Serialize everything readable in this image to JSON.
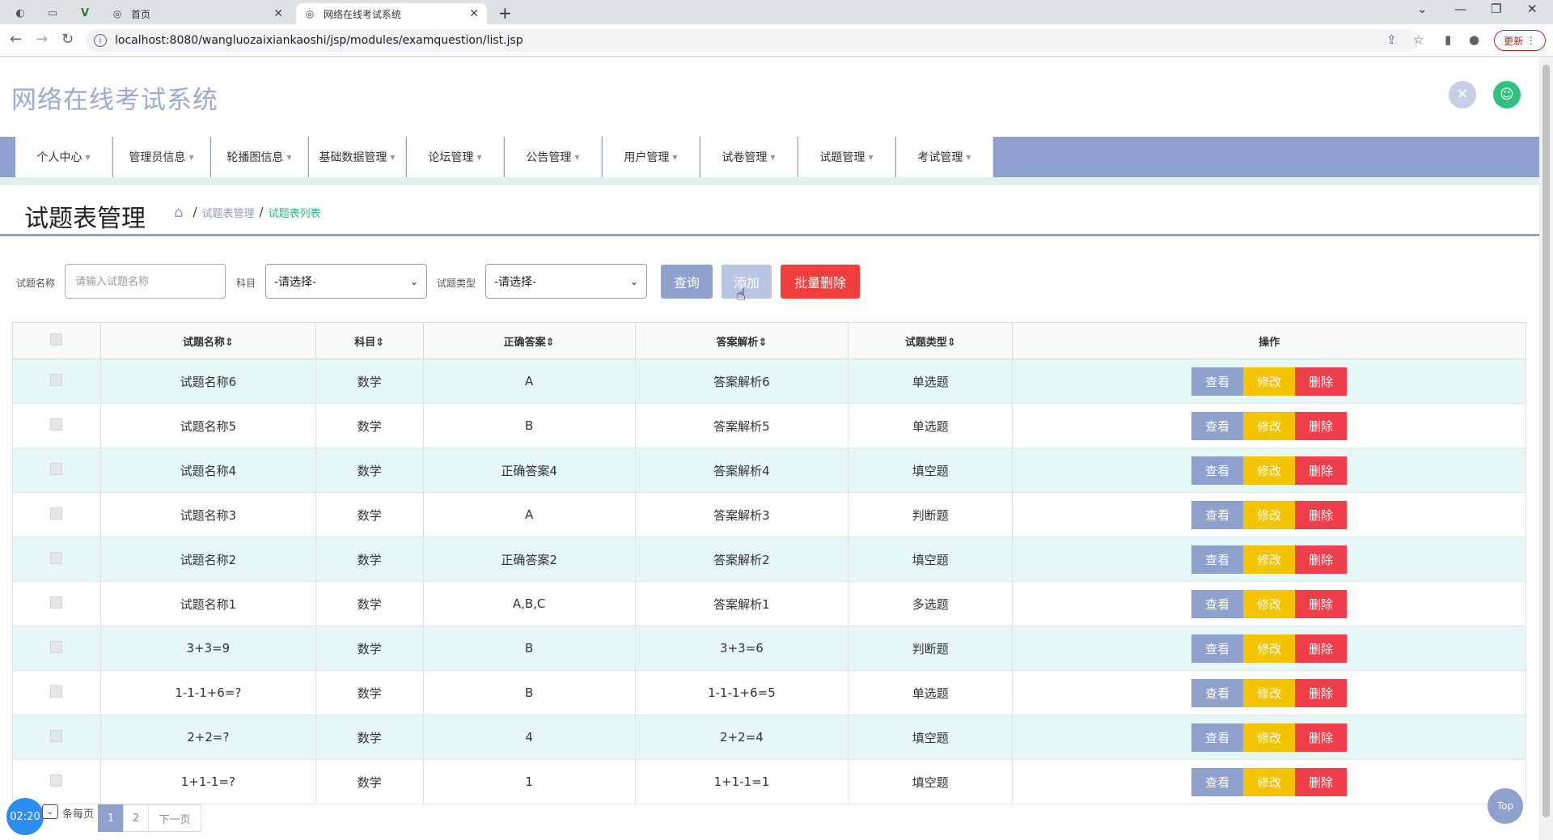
{
  "browser": {
    "tabs": [
      {
        "title": "首页",
        "active": false
      },
      {
        "title": "网络在线考试系统",
        "active": true
      }
    ],
    "url": "localhost:8080/wangluozaixiankaoshi/jsp/modules/examquestion/list.jsp",
    "update_label": "更新"
  },
  "header": {
    "app_title": "网络在线考试系统"
  },
  "menu": [
    "个人中心",
    "管理员信息",
    "轮播图信息",
    "基础数据管理",
    "论坛管理",
    "公告管理",
    "用户管理",
    "试卷管理",
    "试题管理",
    "考试管理"
  ],
  "page": {
    "title": "试题表管理",
    "breadcrumb": [
      "试题表管理",
      "试题表列表"
    ]
  },
  "search": {
    "name_label": "试题名称",
    "name_placeholder": "请输入试题名称",
    "subject_label": "科目",
    "subject_value": "-请选择-",
    "type_label": "试题类型",
    "type_value": "-请选择-",
    "query_label": "查询",
    "add_label": "添加",
    "batch_delete_label": "批量删除"
  },
  "table": {
    "headers": [
      "试题名称",
      "科目",
      "正确答案",
      "答案解析",
      "试题类型",
      "操作"
    ],
    "actions": {
      "view": "查看",
      "edit": "修改",
      "delete": "删除"
    },
    "rows": [
      [
        "试题名称6",
        "数学",
        "A",
        "答案解析6",
        "单选题"
      ],
      [
        "试题名称5",
        "数学",
        "B",
        "答案解析5",
        "单选题"
      ],
      [
        "试题名称4",
        "数学",
        "正确答案4",
        "答案解析4",
        "填空题"
      ],
      [
        "试题名称3",
        "数学",
        "A",
        "答案解析3",
        "判断题"
      ],
      [
        "试题名称2",
        "数学",
        "正确答案2",
        "答案解析2",
        "填空题"
      ],
      [
        "试题名称1",
        "数学",
        "A,B,C",
        "答案解析1",
        "多选题"
      ],
      [
        "3+3=9",
        "数学",
        "B",
        "3+3=6",
        "判断题"
      ],
      [
        "1-1-1+6=?",
        "数学",
        "B",
        "1-1-1+6=5",
        "单选题"
      ],
      [
        "2+2=?",
        "数学",
        "4",
        "2+2=4",
        "填空题"
      ],
      [
        "1+1-1=?",
        "数学",
        "1",
        "1+1-1=1",
        "填空题"
      ]
    ]
  },
  "footer": {
    "clock": "02:20",
    "per_page_label": "条每页",
    "pages": [
      "1",
      "2"
    ],
    "next_label": "下一页",
    "top_label": "Top"
  },
  "colors": {
    "accent": "#8ea0cc",
    "edit": "#f5c400",
    "danger": "#ef3e4c",
    "row_alt": "#e6f7f8"
  }
}
